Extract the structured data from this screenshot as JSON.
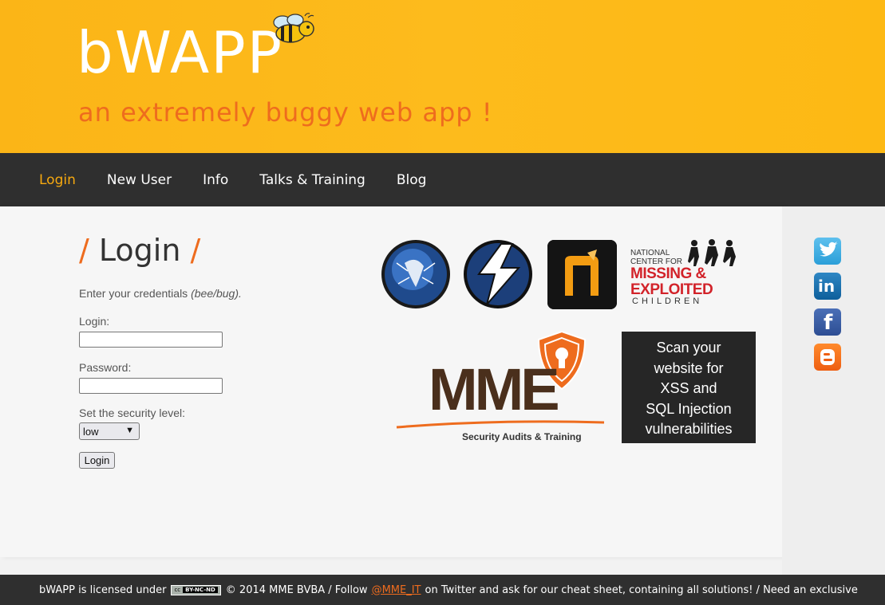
{
  "header": {
    "logo_text": "bWAPP",
    "tagline": "an extremely buggy web app !"
  },
  "nav": {
    "items": [
      {
        "label": "Login",
        "active": true
      },
      {
        "label": "New User"
      },
      {
        "label": "Info"
      },
      {
        "label": "Talks & Training"
      },
      {
        "label": "Blog"
      }
    ]
  },
  "main": {
    "title": "Login",
    "title_slash": "/",
    "intro_text": "Enter your credentials",
    "intro_hint": "(bee/bug).",
    "login_label": "Login:",
    "login_value": "",
    "password_label": "Password:",
    "password_value": "",
    "security_label": "Set the security level:",
    "security_selected": "low",
    "submit_label": "Login"
  },
  "sponsors": {
    "ncmec_line1": "NATIONAL",
    "ncmec_line2": "CENTER FOR",
    "ncmec_line3": "MISSING &",
    "ncmec_line4": "EXPLOITED",
    "ncmec_line5": "CHILDREN",
    "mme_text": "MME",
    "mme_sub": "Security Audits & Training",
    "scan_lines": [
      "Scan your",
      "website for",
      "XSS and",
      "SQL Injection",
      "vulnerabilities"
    ]
  },
  "social": {
    "icons": [
      "twitter-icon",
      "linkedin-icon",
      "facebook-icon",
      "blogger-icon"
    ]
  },
  "footer": {
    "text_before": "bWAPP is licensed under",
    "cc_badge": "cc",
    "cc_terms": "BY-NC-ND",
    "text_middle": "© 2014 MME BVBA / Follow",
    "link": "@MME_IT",
    "text_after": "on Twitter and ask for our cheat sheet, containing all solutions! / Need an exclusive"
  },
  "colors": {
    "header_bg": "#fdb914",
    "accent_orange": "#ee6c1e",
    "nav_bg": "#2f2f2f",
    "nav_active": "#f7a90f"
  }
}
